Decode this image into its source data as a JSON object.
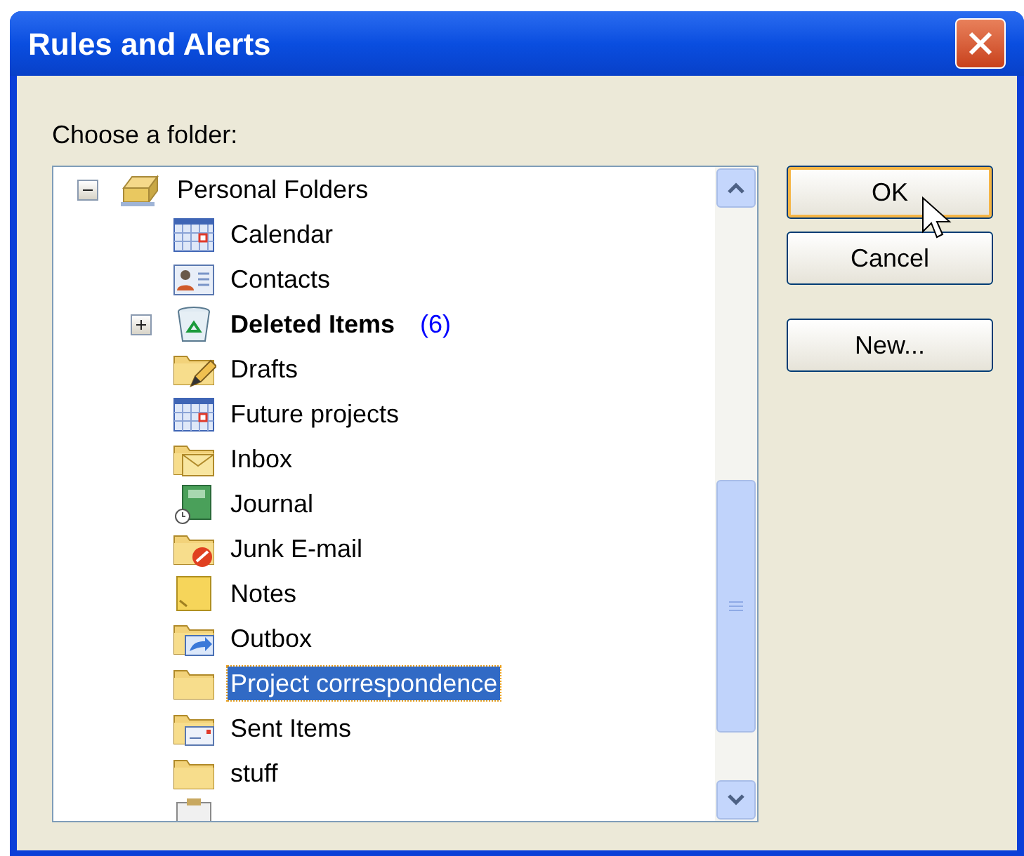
{
  "window": {
    "title": "Rules and Alerts"
  },
  "prompt": "Choose a folder:",
  "tree": [
    {
      "label": "Personal Folders",
      "kind": "personal",
      "expanded": true,
      "selected": false,
      "children": [
        {
          "label": "Calendar",
          "kind": "calendar",
          "selected": false
        },
        {
          "label": "Contacts",
          "kind": "contacts",
          "selected": false
        },
        {
          "label": "Deleted Items",
          "kind": "deleted",
          "bold": true,
          "count": "(6)",
          "expanded": false,
          "selected": false
        },
        {
          "label": "Drafts",
          "kind": "drafts",
          "selected": false
        },
        {
          "label": "Future projects",
          "kind": "calendar",
          "selected": false
        },
        {
          "label": "Inbox",
          "kind": "inbox",
          "selected": false
        },
        {
          "label": "Journal",
          "kind": "journal",
          "selected": false
        },
        {
          "label": "Junk E-mail",
          "kind": "junk",
          "selected": false
        },
        {
          "label": "Notes",
          "kind": "notes",
          "selected": false
        },
        {
          "label": "Outbox",
          "kind": "outbox",
          "selected": false
        },
        {
          "label": "Project correspondence",
          "kind": "folder",
          "selected": true
        },
        {
          "label": "Sent Items",
          "kind": "sent",
          "selected": false
        },
        {
          "label": "stuff",
          "kind": "folder",
          "selected": false
        }
      ]
    }
  ],
  "buttons": [
    {
      "label": "OK",
      "default": true
    },
    {
      "label": "Cancel",
      "default": false
    },
    {
      "label": "New..."
    }
  ]
}
